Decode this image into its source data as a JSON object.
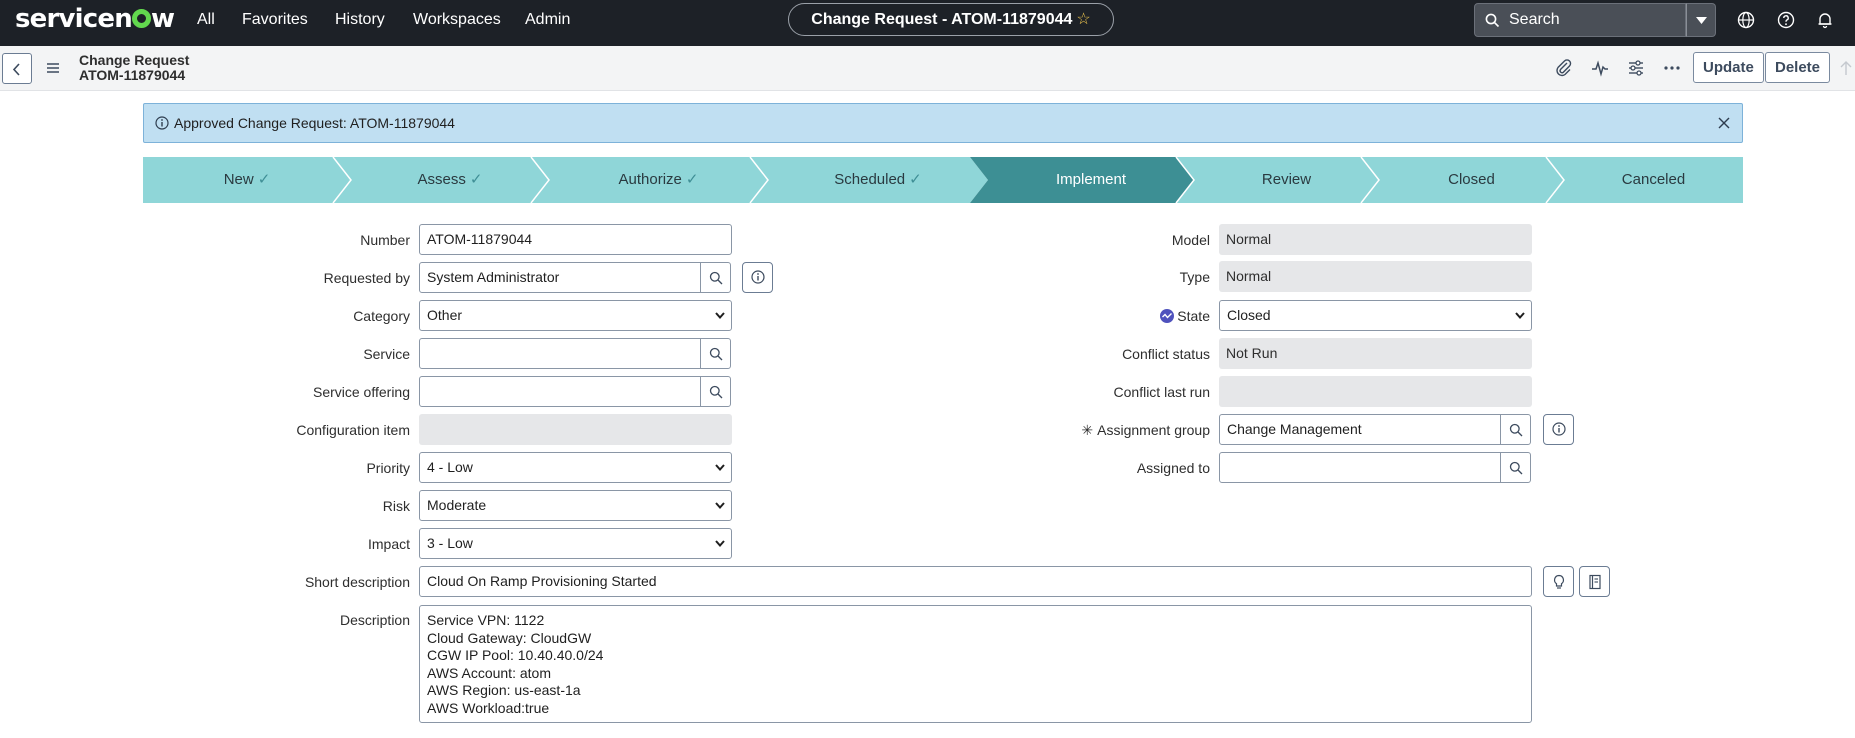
{
  "topnav": {
    "logo": "servicenow",
    "items": [
      "All",
      "Favorites",
      "History",
      "Workspaces",
      "Admin"
    ],
    "record_pill": "Change Request - ATOM-11879044",
    "search_label": "Search"
  },
  "header": {
    "table_name": "Change Request",
    "record_number": "ATOM-11879044",
    "update_label": "Update",
    "delete_label": "Delete"
  },
  "alert": {
    "message": "Approved Change Request: ATOM-11879044"
  },
  "stages": [
    {
      "label": "New",
      "done": true
    },
    {
      "label": "Assess",
      "done": true
    },
    {
      "label": "Authorize",
      "done": true
    },
    {
      "label": "Scheduled",
      "done": true
    },
    {
      "label": "Implement",
      "done": false,
      "active": true
    },
    {
      "label": "Review",
      "done": false
    },
    {
      "label": "Closed",
      "done": false
    },
    {
      "label": "Canceled",
      "done": false
    }
  ],
  "form": {
    "left": {
      "number": {
        "label": "Number",
        "value": "ATOM-11879044"
      },
      "requested_by": {
        "label": "Requested by",
        "value": "System Administrator"
      },
      "category": {
        "label": "Category",
        "value": "Other"
      },
      "service": {
        "label": "Service",
        "value": ""
      },
      "service_offering": {
        "label": "Service offering",
        "value": ""
      },
      "configuration_item": {
        "label": "Configuration item",
        "value": ""
      },
      "priority": {
        "label": "Priority",
        "value": "4 - Low"
      },
      "risk": {
        "label": "Risk",
        "value": "Moderate"
      },
      "impact": {
        "label": "Impact",
        "value": "3 - Low"
      }
    },
    "right": {
      "model": {
        "label": "Model",
        "value": "Normal"
      },
      "type": {
        "label": "Type",
        "value": "Normal"
      },
      "state": {
        "label": "State",
        "value": "Closed"
      },
      "conflict_status": {
        "label": "Conflict status",
        "value": "Not Run"
      },
      "conflict_last_run": {
        "label": "Conflict last run",
        "value": ""
      },
      "assignment_group": {
        "label": "Assignment group",
        "value": "Change Management"
      },
      "assigned_to": {
        "label": "Assigned to",
        "value": ""
      }
    },
    "short_description": {
      "label": "Short description",
      "value": "Cloud On Ramp  Provisioning Started"
    },
    "description": {
      "label": "Description",
      "lines": [
        "Service VPN: 1122",
        "Cloud Gateway: CloudGW",
        "CGW IP Pool: 10.40.40.0/24",
        "AWS Account: atom",
        "AWS Region: us-east-1a",
        "AWS Workload:true"
      ]
    }
  },
  "colors": {
    "topbar": "#1d2127",
    "stage_fill": "#8fd6d8",
    "stage_active": "#3d8f94",
    "alert_bg": "#c0dff2",
    "brand_green": "#62d84e"
  }
}
